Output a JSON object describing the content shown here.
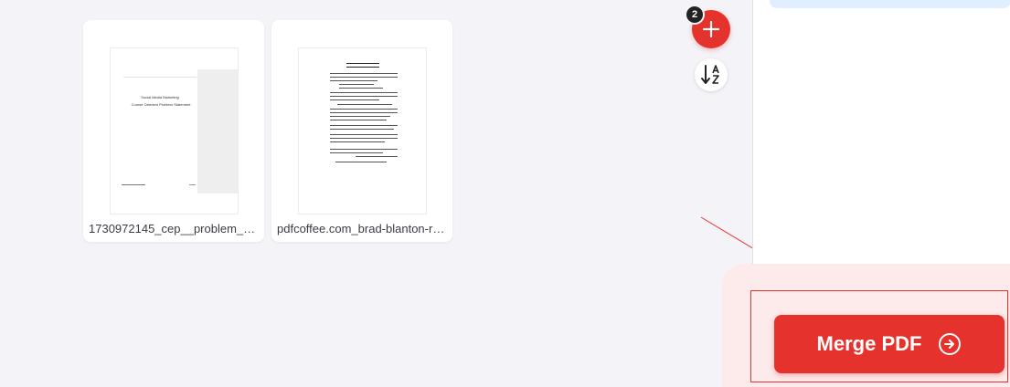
{
  "files": [
    {
      "name": "1730972145_cep__problem_stat...",
      "preview_text": [
        "Social Media Marketing",
        "Course Oriented Problem Statement"
      ]
    },
    {
      "name": "pdfcoffee.com_brad-blanton-ra...",
      "preview_text": []
    }
  ],
  "toolbar": {
    "file_count_badge": "2",
    "add_icon": "plus-icon",
    "sort_icon": "sort-a-z-icon"
  },
  "sidebar": {
    "merge_label": "Merge PDF",
    "merge_icon": "arrow-circle-right-icon"
  },
  "colors": {
    "accent": "#e5322d",
    "background": "#f4f4f8",
    "action_bg": "#fdeaea",
    "info_bar": "#e0efff"
  }
}
